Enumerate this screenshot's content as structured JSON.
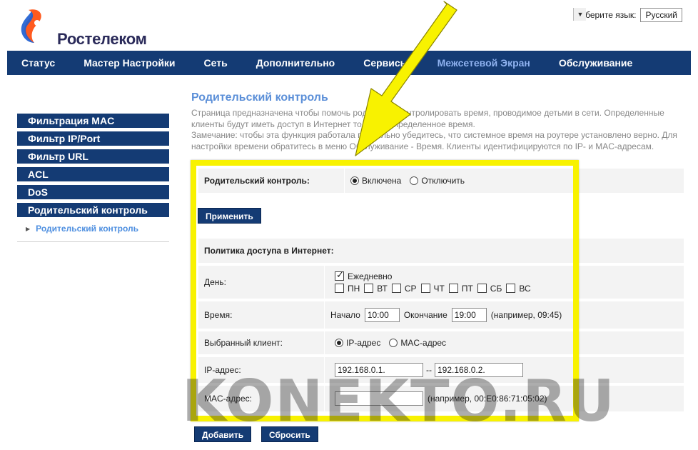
{
  "brand": {
    "name": "Ростелеком",
    "colors": {
      "nav": "#143b74",
      "accent": "#5b8fd8",
      "highlight": "#f8f200"
    }
  },
  "language": {
    "label": "Выберите язык:",
    "selected": "Русский"
  },
  "topnav": {
    "items": [
      {
        "label": "Статус"
      },
      {
        "label": "Мастер Настройки"
      },
      {
        "label": "Сеть"
      },
      {
        "label": "Дополнительно"
      },
      {
        "label": "Сервисы"
      },
      {
        "label": "Межсетевой Экран",
        "active": true
      },
      {
        "label": "Обслуживание"
      }
    ]
  },
  "sidebar": {
    "items": [
      {
        "label": "Фильтрация MAC"
      },
      {
        "label": "Фильтр IP/Port"
      },
      {
        "label": "Фильтр URL"
      },
      {
        "label": "ACL"
      },
      {
        "label": "DoS"
      },
      {
        "label": "Родительский контроль"
      }
    ],
    "sub_item": "Родительский контроль"
  },
  "page": {
    "title": "Родительский контроль",
    "description_1": "Страница предназначена чтобы помочь родителям контролировать время, проводимое детьми в сети. Определенные клиенты будут иметь доступ в Интернет только в определенное время.",
    "description_2": "Замечание: чтобы эта функция работала правильно убедитесь, что системное время на роутере установлено верно. Для настройки времени обратитесь в меню Обслуживание - Время. Клиенты идентифицируются по IP- и MAC-адресам."
  },
  "control": {
    "label": "Родительский контроль:",
    "on_label": "Включена",
    "off_label": "Отключить",
    "apply": "Применить"
  },
  "policy": {
    "heading": "Политика доступа в Интернет:",
    "day_label": "День:",
    "daily": "Ежедневно",
    "days": [
      "ПН",
      "ВТ",
      "СР",
      "ЧТ",
      "ПТ",
      "СБ",
      "ВС"
    ],
    "time_label": "Время:",
    "start_label": "Начало",
    "start_value": "10:00",
    "end_label": "Окончание",
    "end_value": "19:00",
    "time_hint": "(например, 09:45)",
    "client_label": "Выбранный клиент:",
    "ip_option": "IP-адрес",
    "mac_option": "MAC-адрес",
    "ip_label": "IP-адрес:",
    "ip_from": "192.168.0.1.",
    "ip_dash": "--",
    "ip_to": "192.168.0.2.",
    "mac_label": "MAC-адрес:",
    "mac_value": "",
    "mac_hint": "(например, 00:E0:86:71:05:02)"
  },
  "buttons": {
    "add": "Добавить",
    "reset": "Сбросить"
  },
  "watermark": "KONEKTO.RU"
}
